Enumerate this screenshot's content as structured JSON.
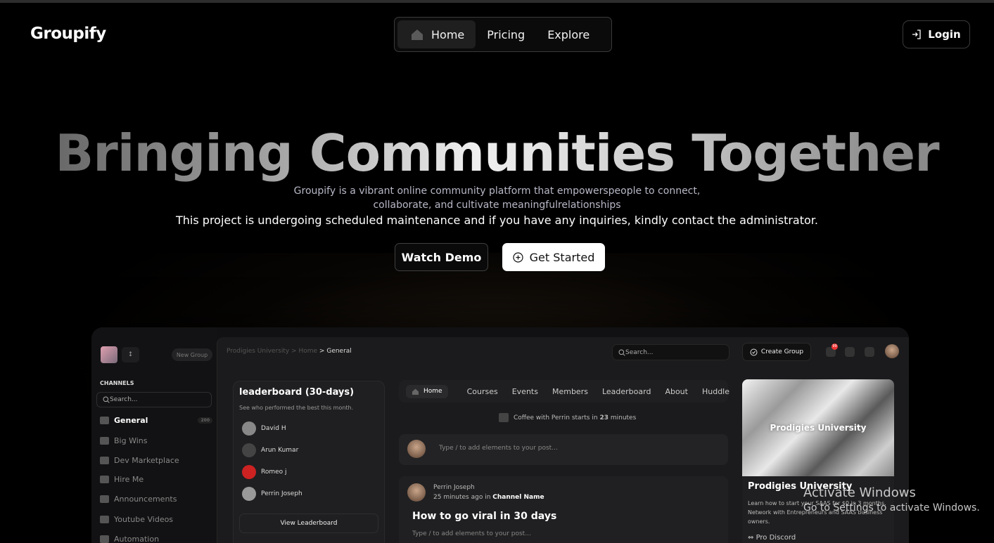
{
  "brand": "Groupify",
  "nav": {
    "home": "Home",
    "pricing": "Pricing",
    "explore": "Explore"
  },
  "login_label": "Login",
  "hero": {
    "title": "Bringing Communities Together",
    "sub1": "Groupify is a vibrant online community platform that empowerspeople to connect,",
    "sub2": "collaborate, and cultivate meaningfulrelationships",
    "maintenance": "This project is undergoing scheduled maintenance and if you have any inquiries, kindly contact the administrator.",
    "watch_demo": "Watch Demo",
    "get_started": "Get Started"
  },
  "preview": {
    "new_group": "New Group",
    "selector": "↕",
    "channels_heading": "CHANNELS",
    "channel_search": "Search...",
    "channels": [
      {
        "label": "General",
        "badge": "200"
      },
      {
        "label": "Big Wins"
      },
      {
        "label": "Dev Marketplace"
      },
      {
        "label": "Hire Me"
      },
      {
        "label": "Announcements"
      },
      {
        "label": "Youtube Videos"
      },
      {
        "label": "Automation"
      }
    ],
    "breadcrumb": {
      "org": "Prodigies University >",
      "home": "Home",
      "sep": ">",
      "current": "General"
    },
    "search": "Search...",
    "create_group": "Create Group",
    "notif_count": "99",
    "leaderboard": {
      "title": "leaderboard (30-days)",
      "subtitle": "See who performed the best this month.",
      "rows": [
        "David H",
        "Arun Kumar",
        "Romeo j",
        "Perrin Joseph"
      ],
      "button": "View Leaderboard"
    },
    "tabs": [
      "Home",
      "Courses",
      "Events",
      "Members",
      "Leaderboard",
      "About",
      "Huddle"
    ],
    "event": {
      "prefix": "Coffee with Perrin starts in",
      "count": "23",
      "suffix": "minutes"
    },
    "composer_placeholder": "Type / to add elements to your post...",
    "post": {
      "author": "Perrin Joseph",
      "meta_prefix": "25 minutes ago in",
      "channel": "Channel Name",
      "title": "How to go viral in 30 days",
      "placeholder": "Type / to add elements to your post..."
    },
    "card": {
      "image_text": "Prodigies University",
      "title": "Prodigies University",
      "description": "Learn how to start your SAAS for $0 in 3 months. Network with Entrepreneurs and SAAS business owners.",
      "link": "Pro Discord"
    }
  },
  "activate": {
    "line1": "Activate Windows",
    "line2": "Go to Settings to activate Windows."
  }
}
